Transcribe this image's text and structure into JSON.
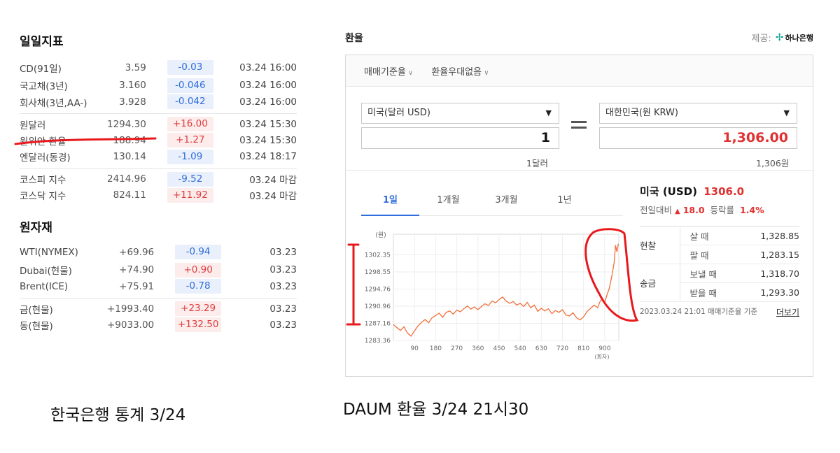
{
  "left": {
    "section1_title": "일일지표",
    "rows1": [
      {
        "name": "CD(91일)",
        "value": "3.59",
        "change": "-0.03",
        "dir": "down",
        "time": "03.24 16:00"
      },
      {
        "name": "국고채(3년)",
        "value": "3.160",
        "change": "-0.046",
        "dir": "down",
        "time": "03.24 16:00"
      },
      {
        "name": "회사채(3년,AA-)",
        "value": "3.928",
        "change": "-0.042",
        "dir": "down",
        "time": "03.24 16:00"
      },
      {
        "name": "원달러",
        "value": "1294.30",
        "change": "+16.00",
        "dir": "up",
        "time": "03.24 15:30"
      },
      {
        "name": "원위안 환율",
        "value": "188.94",
        "change": "+1.27",
        "dir": "up",
        "time": "03.24 15:30"
      },
      {
        "name": "엔달러(동경)",
        "value": "130.14",
        "change": "-1.09",
        "dir": "down",
        "time": "03.24 18:17"
      },
      {
        "name": "코스피 지수",
        "value": "2414.96",
        "change": "-9.52",
        "dir": "down",
        "time": "03.24 마감"
      },
      {
        "name": "코스닥 지수",
        "value": "824.11",
        "change": "+11.92",
        "dir": "up",
        "time": "03.24 마감"
      }
    ],
    "section2_title": "원자재",
    "rows2": [
      {
        "name": "WTI(NYMEX)",
        "value": "+69.96",
        "change": "-0.94",
        "dir": "down",
        "time": "03.23"
      },
      {
        "name": "Dubai(현물)",
        "value": "+74.90",
        "change": "+0.90",
        "dir": "up",
        "time": "03.23"
      },
      {
        "name": "Brent(ICE)",
        "value": "+75.91",
        "change": "-0.78",
        "dir": "down",
        "time": "03.23"
      },
      {
        "name": "금(현물)",
        "value": "+1993.40",
        "change": "+23.29",
        "dir": "up",
        "time": "03.23"
      },
      {
        "name": "동(현물)",
        "value": "+9033.00",
        "change": "+132.50",
        "dir": "up",
        "time": "03.23"
      }
    ],
    "caption": "한국은행 통계 3/24"
  },
  "right": {
    "title": "환율",
    "provider_label": "제공:",
    "provider_name": "하나은행",
    "options": [
      "매매기준율",
      "환율우대없음"
    ],
    "from_currency": "미국(달러 USD)",
    "to_currency": "대한민국(원 KRW)",
    "from_amount": "1",
    "to_amount": "1,306.00",
    "from_sub": "1달러",
    "to_sub": "1,306원",
    "tabs": [
      "1일",
      "1개월",
      "3개월",
      "1년"
    ],
    "active_tab": 0,
    "country_label": "미국 (USD)",
    "rate": "1306.0",
    "prev_label": "전일대비",
    "prev_change": "18.0",
    "rate_label": "등락률",
    "rate_pct": "1.4%",
    "groups": [
      {
        "group": "현찰",
        "rows": [
          {
            "label": "살 때",
            "value": "1,328.85"
          },
          {
            "label": "팔 때",
            "value": "1,283.15"
          }
        ]
      },
      {
        "group": "송금",
        "rows": [
          {
            "label": "보낼 때",
            "value": "1,318.70"
          },
          {
            "label": "받을 때",
            "value": "1,293.30"
          }
        ]
      }
    ],
    "foot_text": "2023.03.24 21:01 매매기준율 기준",
    "more_label": "더보기",
    "caption": "DAUM 환율 3/24 21시30"
  },
  "chart_data": {
    "type": "line",
    "ylabel": "(원)",
    "xlabel": "(회차)",
    "yticks": [
      1283.36,
      1287.16,
      1290.96,
      1294.76,
      1298.55,
      1302.35
    ],
    "xticks": [
      90,
      180,
      270,
      360,
      450,
      540,
      630,
      720,
      810,
      900
    ],
    "xlim": [
      0,
      960
    ],
    "ylim": [
      1283.36,
      1306.0
    ],
    "color": "#f0703a",
    "points": [
      [
        0,
        1286.9
      ],
      [
        15,
        1286.2
      ],
      [
        30,
        1285.6
      ],
      [
        45,
        1286.4
      ],
      [
        60,
        1285.0
      ],
      [
        75,
        1284.3
      ],
      [
        90,
        1285.5
      ],
      [
        105,
        1286.6
      ],
      [
        120,
        1287.4
      ],
      [
        135,
        1288.0
      ],
      [
        150,
        1287.3
      ],
      [
        165,
        1288.4
      ],
      [
        180,
        1288.9
      ],
      [
        195,
        1289.4
      ],
      [
        210,
        1288.5
      ],
      [
        225,
        1289.6
      ],
      [
        240,
        1289.9
      ],
      [
        255,
        1289.2
      ],
      [
        270,
        1290.1
      ],
      [
        285,
        1289.7
      ],
      [
        300,
        1290.4
      ],
      [
        315,
        1291.0
      ],
      [
        330,
        1290.3
      ],
      [
        345,
        1290.8
      ],
      [
        360,
        1290.2
      ],
      [
        375,
        1290.9
      ],
      [
        390,
        1291.5
      ],
      [
        405,
        1291.1
      ],
      [
        420,
        1292.1
      ],
      [
        435,
        1291.7
      ],
      [
        450,
        1292.4
      ],
      [
        465,
        1293.0
      ],
      [
        480,
        1292.1
      ],
      [
        495,
        1291.6
      ],
      [
        510,
        1292.0
      ],
      [
        525,
        1291.2
      ],
      [
        540,
        1291.6
      ],
      [
        555,
        1290.9
      ],
      [
        570,
        1291.8
      ],
      [
        585,
        1290.6
      ],
      [
        600,
        1291.2
      ],
      [
        615,
        1289.8
      ],
      [
        630,
        1290.5
      ],
      [
        645,
        1289.9
      ],
      [
        660,
        1290.4
      ],
      [
        675,
        1289.3
      ],
      [
        690,
        1290.0
      ],
      [
        705,
        1289.6
      ],
      [
        720,
        1290.2
      ],
      [
        735,
        1289.0
      ],
      [
        750,
        1288.8
      ],
      [
        765,
        1289.5
      ],
      [
        780,
        1288.4
      ],
      [
        795,
        1287.9
      ],
      [
        810,
        1288.6
      ],
      [
        825,
        1289.8
      ],
      [
        840,
        1290.5
      ],
      [
        855,
        1291.2
      ],
      [
        870,
        1290.6
      ],
      [
        880,
        1292.0
      ],
      [
        890,
        1292.6
      ],
      [
        900,
        1291.8
      ],
      [
        910,
        1293.5
      ],
      [
        920,
        1295.0
      ],
      [
        930,
        1297.5
      ],
      [
        940,
        1300.5
      ],
      [
        946,
        1304.5
      ],
      [
        952,
        1303.0
      ],
      [
        958,
        1304.8
      ]
    ]
  }
}
